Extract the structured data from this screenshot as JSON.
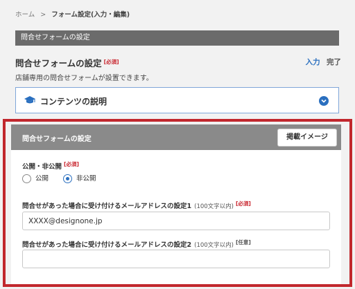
{
  "breadcrumb": {
    "home": "ホーム",
    "separator": ">",
    "current": "フォーム設定(入力・編集)"
  },
  "section_bar": {
    "title": "問合せフォームの設定"
  },
  "form_header": {
    "title": "問合せフォームの設定",
    "required_badge": "[必須]",
    "tab_input": "入力",
    "tab_done": "完了",
    "description": "店舗専用の問合せフォームが設置できます。"
  },
  "accordion": {
    "label": "コンテンツの説明",
    "icon": "graduation-cap-icon",
    "toggle_icon": "chevron-down-icon"
  },
  "card": {
    "title": "問合せフォームの設定",
    "preview_button": "掲載イメージ",
    "visibility": {
      "label": "公開・非公開",
      "badge": "[必須]",
      "options": [
        {
          "label": "公開",
          "selected": false
        },
        {
          "label": "非公開",
          "selected": true
        }
      ]
    },
    "email1": {
      "label": "問合せがあった場合に受け付けるメールアドレスの設定1",
      "hint": "(100文字以内)",
      "badge": "[必須]",
      "value": "XXXX@designone.jp"
    },
    "email2": {
      "label": "問合せがあった場合に受け付けるメールアドレスの設定2",
      "hint": "(100文字以内)",
      "badge": "[任意]",
      "value": ""
    }
  },
  "colors": {
    "accent": "#2a6fbf",
    "required": "#c8232c",
    "highlight": "#c1272d",
    "section_bar": "#6b6b6b",
    "card_header": "#8a8a8a"
  }
}
